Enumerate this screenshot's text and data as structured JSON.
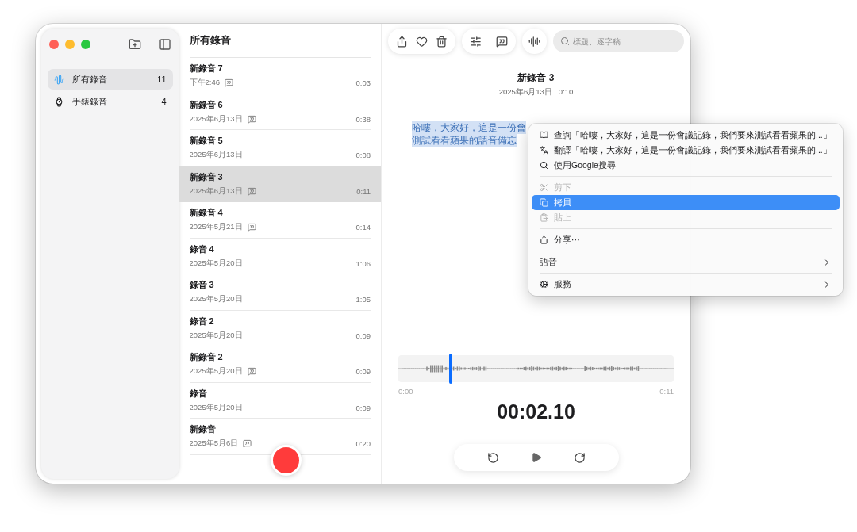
{
  "sidebar": {
    "items": [
      {
        "kind": "all",
        "label": "所有錄音",
        "count": "11",
        "selected": true
      },
      {
        "kind": "watch",
        "label": "手錶錄音",
        "count": "4",
        "selected": false
      }
    ]
  },
  "list": {
    "title": "所有錄音",
    "rows": [
      {
        "title": "新錄音 7",
        "date": "下午2:46",
        "transcript": true,
        "duration": "0:03",
        "selected": false
      },
      {
        "title": "新錄音 6",
        "date": "2025年6月13日",
        "transcript": true,
        "duration": "0:38",
        "selected": false
      },
      {
        "title": "新錄音 5",
        "date": "2025年6月13日",
        "transcript": false,
        "duration": "0:08",
        "selected": false
      },
      {
        "title": "新錄音 3",
        "date": "2025年6月13日",
        "transcript": true,
        "duration": "0:11",
        "selected": true
      },
      {
        "title": "新錄音 4",
        "date": "2025年5月21日",
        "transcript": true,
        "duration": "0:14",
        "selected": false
      },
      {
        "title": "錄音 4",
        "date": "2025年5月20日",
        "transcript": false,
        "duration": "1:06",
        "selected": false
      },
      {
        "title": "錄音 3",
        "date": "2025年5月20日",
        "transcript": false,
        "duration": "1:05",
        "selected": false
      },
      {
        "title": "錄音 2",
        "date": "2025年5月20日",
        "transcript": false,
        "duration": "0:09",
        "selected": false
      },
      {
        "title": "新錄音 2",
        "date": "2025年5月20日",
        "transcript": true,
        "duration": "0:09",
        "selected": false
      },
      {
        "title": "錄音",
        "date": "2025年5月20日",
        "transcript": false,
        "duration": "0:09",
        "selected": false
      },
      {
        "title": "新錄音",
        "date": "2025年5月6日",
        "transcript": true,
        "duration": "0:20",
        "selected": false
      }
    ]
  },
  "detail": {
    "search": {
      "placeholder": "標題、逐字稿"
    },
    "title": "新錄音 3",
    "date": "2025年6月13日",
    "length": "0:10",
    "transcript_lines": [
      "哈嘍，大家好，這是一份會",
      "測試看看蘋果的語音備忘"
    ],
    "scrubber": {
      "level": 0.19,
      "start": "0:00",
      "end": "0:11"
    },
    "timer": "00:02.10"
  },
  "menu": {
    "items": [
      {
        "kind": "lookup",
        "label": "查詢「哈嘍，大家好，這是一份會議記錄，我們要來測試看看蘋果的...」",
        "disabled": false,
        "selected": false
      },
      {
        "kind": "translate",
        "label": "翻譯「哈嘍，大家好，這是一份會議記錄，我們要來測試看看蘋果的...」",
        "disabled": false,
        "selected": false
      },
      {
        "kind": "search",
        "label": "使用Google搜尋",
        "disabled": false,
        "selected": false
      },
      {
        "kind": "separator"
      },
      {
        "kind": "cut",
        "label": "剪下",
        "disabled": true,
        "selected": false
      },
      {
        "kind": "copy",
        "label": "拷貝",
        "disabled": false,
        "selected": true
      },
      {
        "kind": "paste",
        "label": "貼上",
        "disabled": true,
        "selected": false
      },
      {
        "kind": "separator"
      },
      {
        "kind": "share",
        "label": "分享⋯",
        "disabled": false,
        "selected": false
      },
      {
        "kind": "separator"
      },
      {
        "kind": "submenu",
        "label": "語音",
        "disabled": false,
        "selected": false
      },
      {
        "kind": "separator"
      },
      {
        "kind": "services",
        "label": "服務",
        "disabled": false,
        "selected": false
      }
    ]
  }
}
